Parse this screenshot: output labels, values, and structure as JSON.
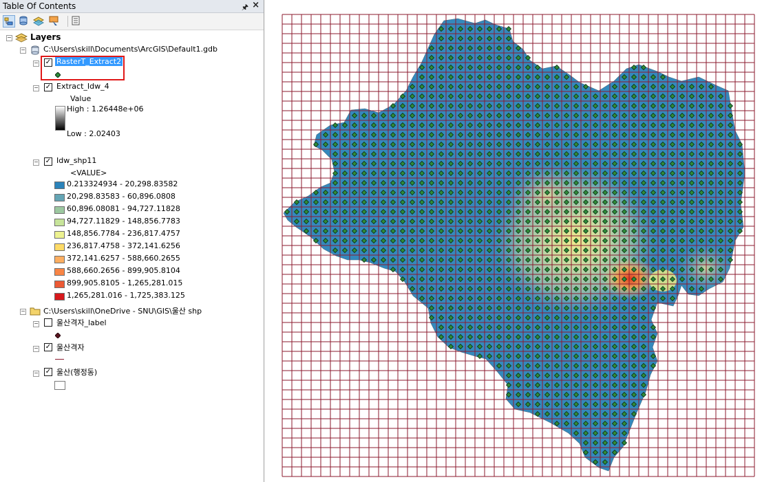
{
  "toc": {
    "title": "Table Of Contents",
    "pin_icon": "pin-icon",
    "close_icon": "close-icon",
    "toolbar": [
      "list-by-drawing-order-icon",
      "list-by-source-icon",
      "list-by-visibility-icon",
      "list-by-selection-icon",
      "options-icon"
    ],
    "root": "Layers",
    "gdb": "C:\\Users\\skill\\Documents\\ArcGIS\\Default1.gdb",
    "raster_extract": "RasterT_Extract2",
    "extract_idw": {
      "name": "Extract_Idw_4",
      "value_label": "Value",
      "high": "High : 1.26448e+06",
      "low": "Low : 2.02403"
    },
    "idw": {
      "name": "Idw_shp11",
      "field": "<VALUE>",
      "classes": [
        {
          "label": "0.213324934 - 20,298.83582",
          "color": "#2b83ba"
        },
        {
          "label": "20,298.83583 - 60,896.0808",
          "color": "#64a5b5"
        },
        {
          "label": "60,896.08081 - 94,727.11828",
          "color": "#9cc8a0"
        },
        {
          "label": "94,727.11829 - 148,856.7783",
          "color": "#c7e49a"
        },
        {
          "label": "148,856.7784 - 236,817.4757",
          "color": "#edf290"
        },
        {
          "label": "236,817.4758 - 372,141.6256",
          "color": "#fedb67"
        },
        {
          "label": "372,141.6257 - 588,660.2655",
          "color": "#fdae61"
        },
        {
          "label": "588,660.2656 - 899,905.8104",
          "color": "#f98545"
        },
        {
          "label": "899,905.8105 - 1,265,281.015",
          "color": "#ec5a35"
        },
        {
          "label": "1,265,281.016 - 1,725,383.125",
          "color": "#d7191c"
        }
      ]
    },
    "shp_folder": "C:\\Users\\skill\\OneDrive - SNU\\GIS\\울산 shp",
    "grid_label_layer": "울산격자_label",
    "grid_layer": "울산격자",
    "admin_layer": "울산(행정동)"
  },
  "map": {
    "grid_color": "#8b1a2e",
    "raster_base_color": "#3489bd",
    "point_color": "#2e8b3a"
  }
}
